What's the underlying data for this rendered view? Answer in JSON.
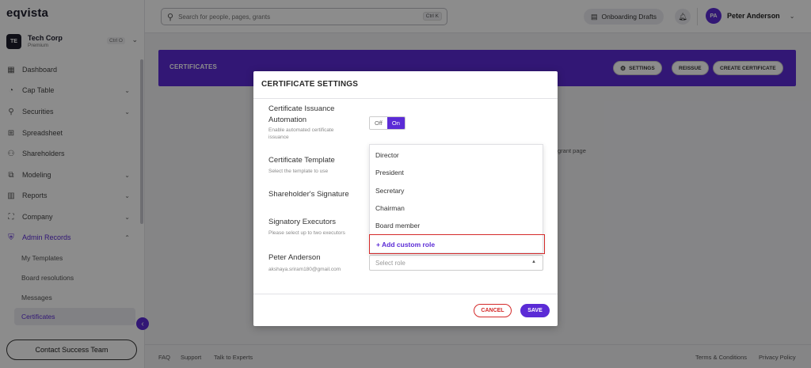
{
  "app": {
    "logo": "eqvista"
  },
  "company": {
    "initials": "TE",
    "name": "Tech Corp",
    "plan": "Premium",
    "shortcut": "Ctrl O"
  },
  "nav": {
    "items": [
      {
        "label": "Dashboard",
        "icon": "dashboard-icon"
      },
      {
        "label": "Cap Table",
        "icon": "pie-chart-icon"
      },
      {
        "label": "Securities",
        "icon": "securities-icon"
      },
      {
        "label": "Spreadsheet",
        "icon": "spreadsheet-icon"
      },
      {
        "label": "Shareholders",
        "icon": "users-icon"
      },
      {
        "label": "Modeling",
        "icon": "modeling-icon"
      },
      {
        "label": "Reports",
        "icon": "reports-icon"
      },
      {
        "label": "Company",
        "icon": "company-icon"
      },
      {
        "label": "Admin Records",
        "icon": "admin-records-icon"
      }
    ],
    "sub_items": [
      {
        "label": "My Templates"
      },
      {
        "label": "Board resolutions"
      },
      {
        "label": "Messages"
      },
      {
        "label": "Certificates"
      }
    ],
    "contact_button": "Contact Success Team"
  },
  "topbar": {
    "search_placeholder": "Search for people, pages, grants",
    "search_shortcut": "Ctrl K",
    "drafts_label": "Onboarding Drafts",
    "user_initials": "PA",
    "user_name": "Peter Anderson"
  },
  "page": {
    "banner_title": "CERTIFICATES",
    "settings_label": "SETTINGS",
    "reissue_label": "REISSUE",
    "create_label": "CREATE CERTIFICATE",
    "bg_hint": "grant page"
  },
  "footer": {
    "faq": "FAQ",
    "support": "Support",
    "talk": "Talk to Experts",
    "terms": "Terms & Conditions",
    "privacy": "Privacy Policy"
  },
  "modal": {
    "title": "CERTIFICATE SETTINGS",
    "automation_label_1": "Certificate Issuance",
    "automation_label_2": "Automation",
    "automation_hint_1": "Enable automated certificate",
    "automation_hint_2": "issuance",
    "toggle_off": "Off",
    "toggle_on": "On",
    "template_label": "Certificate Template",
    "template_hint": "Select the template to use",
    "signature_label": "Shareholder's Signature",
    "executors_label": "Signatory Executors",
    "executors_hint": "Please select up to two executors",
    "executor_name": "Peter Anderson",
    "executor_email": "akshaya.sriram180@gmail.com",
    "roles": [
      "Director",
      "President",
      "Secretary",
      "Chairman",
      "Board member"
    ],
    "add_custom_role": "+ Add custom role",
    "select_role_placeholder": "Select role",
    "cancel_label": "CANCEL",
    "save_label": "SAVE"
  }
}
